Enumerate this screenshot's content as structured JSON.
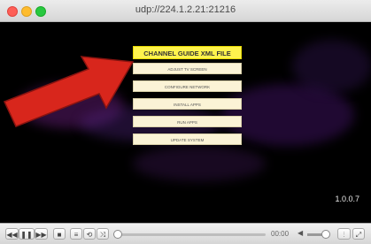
{
  "window": {
    "title": "udp://224.1.2.21:21216"
  },
  "menu": {
    "items": [
      {
        "label": "CHANNEL GUIDE XML FILE",
        "active": true
      },
      {
        "label": "ADJUST TV SCREEN",
        "active": false
      },
      {
        "label": "CONFIGURE NETWORK",
        "active": false
      },
      {
        "label": "INSTALL APPS",
        "active": false
      },
      {
        "label": "RUN APPS",
        "active": false
      },
      {
        "label": "UPDATE SYSTEM",
        "active": false
      }
    ]
  },
  "overlay": {
    "version": "1.0.0.7"
  },
  "controls": {
    "rewind_icon": "rewind-icon",
    "play_pause_icon": "pause-icon",
    "forward_icon": "fast-forward-icon",
    "stop_icon": "stop-icon",
    "playlist_icon": "playlist-icon",
    "loop_icon": "loop-icon",
    "shuffle_icon": "shuffle-icon",
    "time": "00:00",
    "playback_progress": 0,
    "fullscreen_icon": "fullscreen-icon",
    "equalizer_icon": "equalizer-icon"
  },
  "colors": {
    "accent_menu": "#fff34d",
    "menu_bg": "#fbf3d6",
    "arrow": "#d8261c"
  }
}
